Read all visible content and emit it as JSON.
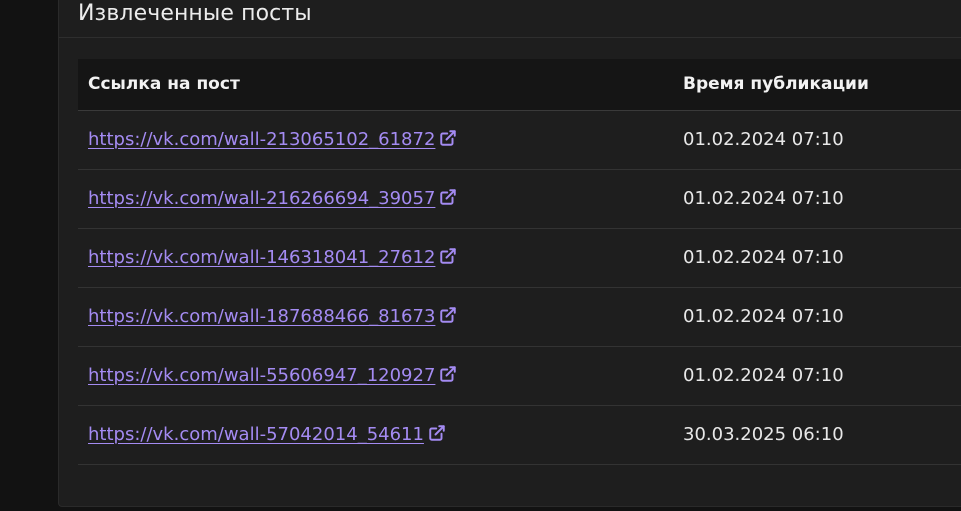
{
  "card": {
    "title": "Извлеченные посты"
  },
  "table": {
    "headers": {
      "link": "Ссылка на пост",
      "time": "Время публикации"
    },
    "rows": [
      {
        "url": "https://vk.com/wall-213065102_61872",
        "time": "01.02.2024 07:10"
      },
      {
        "url": "https://vk.com/wall-216266694_39057",
        "time": "01.02.2024 07:10"
      },
      {
        "url": "https://vk.com/wall-146318041_27612",
        "time": "01.02.2024 07:10"
      },
      {
        "url": "https://vk.com/wall-187688466_81673",
        "time": "01.02.2024 07:10"
      },
      {
        "url": "https://vk.com/wall-55606947_120927",
        "time": "01.02.2024 07:10"
      },
      {
        "url": "https://vk.com/wall-57042014_54611",
        "time": "30.03.2025 06:10"
      }
    ]
  },
  "colors": {
    "link": "#a48bf2",
    "background": "#1e1e1e",
    "header_bg": "#151515"
  },
  "icons": {
    "row_link_icon": "external-link-icon"
  }
}
